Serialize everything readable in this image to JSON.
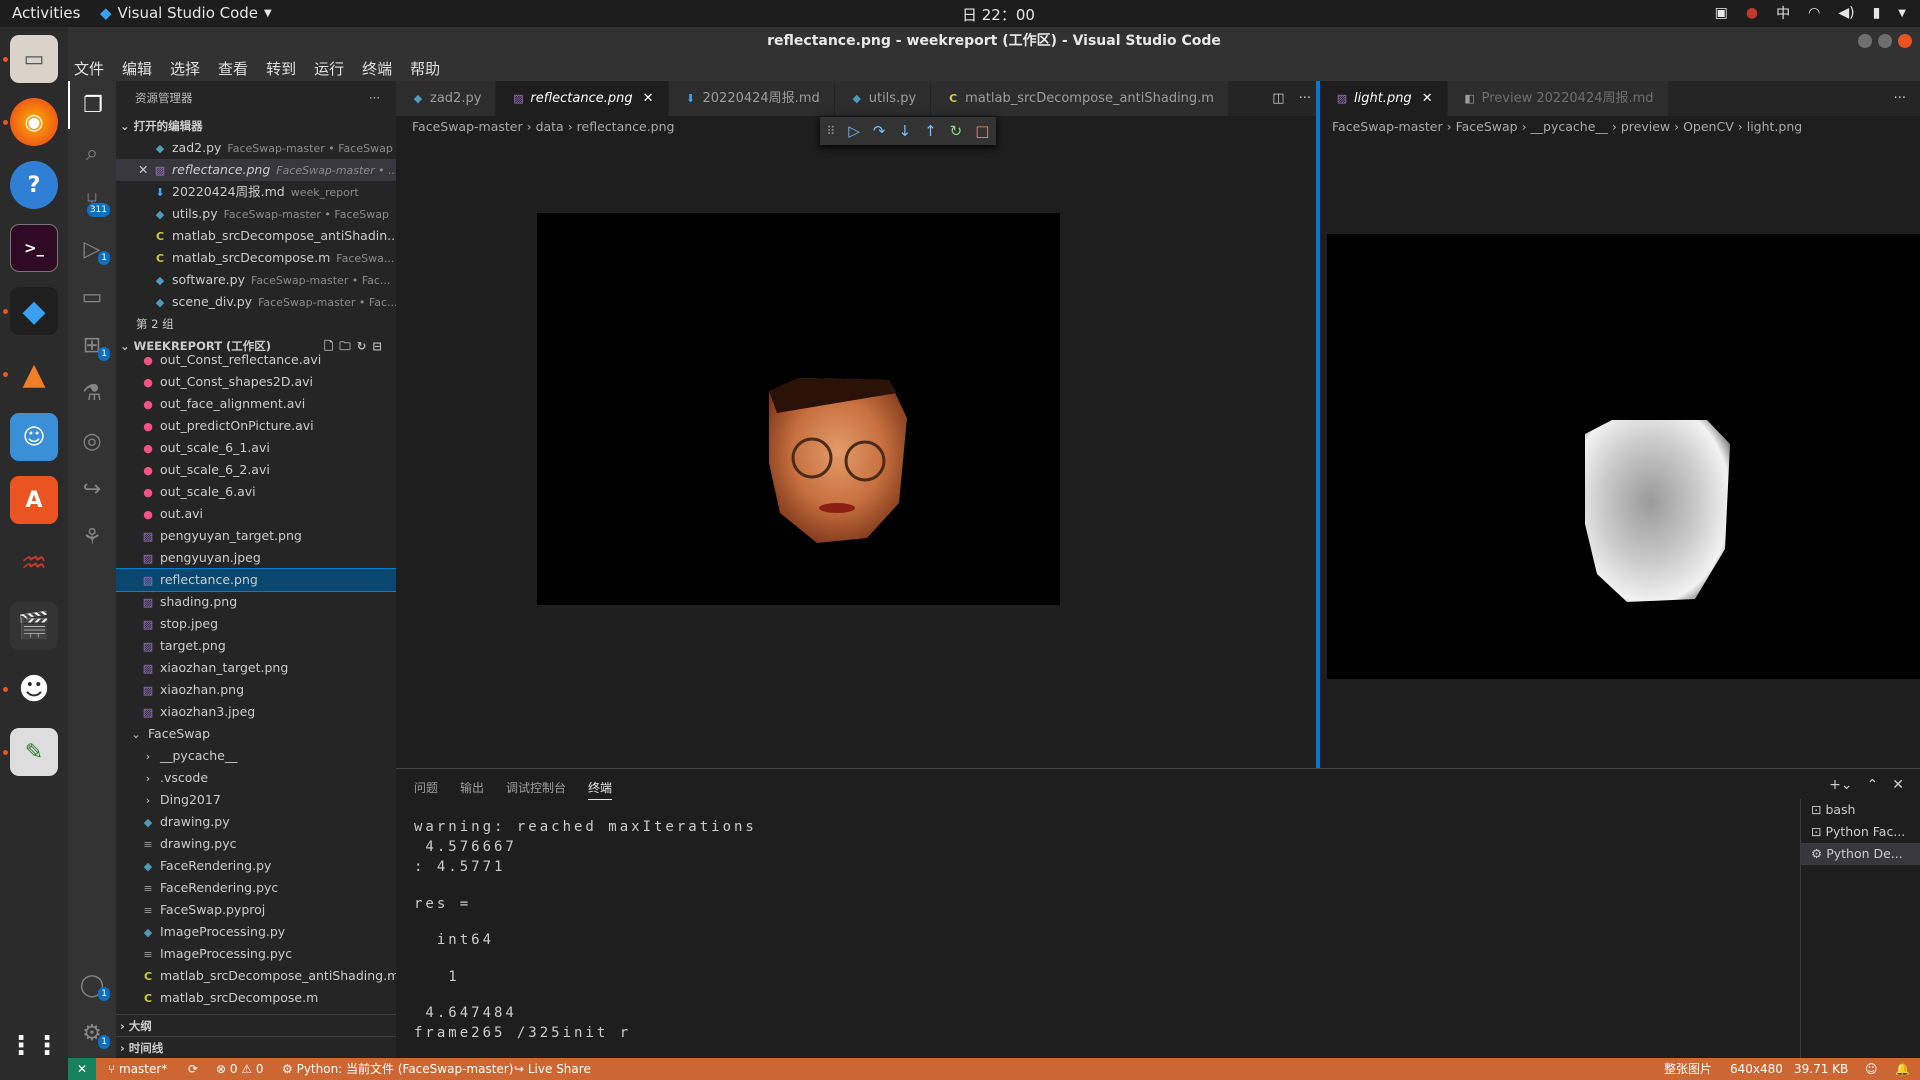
{
  "topbar": {
    "activities": "Activities",
    "app": "Visual Studio Code",
    "clock": "日 22：00",
    "ime": "中"
  },
  "window": {
    "title": "reflectance.png - weekreport (工作区) - Visual Studio Code"
  },
  "menu": [
    "文件",
    "编辑",
    "选择",
    "查看",
    "转到",
    "运行",
    "终端",
    "帮助"
  ],
  "activity": {
    "scm_badge": "311",
    "debug_badge": "1",
    "ext_badge": "1",
    "account_badge": "1",
    "settings_badge": "1"
  },
  "sidebar": {
    "title": "资源管理器",
    "open_editors_title": "打开的编辑器",
    "open_editors": [
      {
        "name": "zad2.py",
        "desc": "FaceSwap-master • FaceSwap",
        "type": "py"
      },
      {
        "name": "reflectance.png",
        "desc": "FaceSwap-master • ...",
        "type": "png"
      },
      {
        "name": "20220424周报.md",
        "desc": "week_report",
        "type": "md"
      },
      {
        "name": "utils.py",
        "desc": "FaceSwap-master • FaceSwap",
        "type": "py"
      },
      {
        "name": "matlab_srcDecompose_antiShadin...",
        "desc": "",
        "type": "cm"
      },
      {
        "name": "matlab_srcDecompose.m",
        "desc": "FaceSwa...",
        "type": "cm"
      },
      {
        "name": "software.py",
        "desc": "FaceSwap-master • Fac...",
        "type": "py"
      },
      {
        "name": "scene_div.py",
        "desc": "FaceSwap-master • Fac...",
        "type": "py"
      }
    ],
    "group2": "第 2 组",
    "workspace_title": "WEEKREPORT (工作区)",
    "files": [
      {
        "name": "out_Const_reflectance.avi",
        "type": "avi",
        "indent": 1
      },
      {
        "name": "out_Const_shapes2D.avi",
        "type": "avi",
        "indent": 1
      },
      {
        "name": "out_face_alignment.avi",
        "type": "avi",
        "indent": 1
      },
      {
        "name": "out_predictOnPicture.avi",
        "type": "avi",
        "indent": 1
      },
      {
        "name": "out_scale_6_1.avi",
        "type": "avi",
        "indent": 1
      },
      {
        "name": "out_scale_6_2.avi",
        "type": "avi",
        "indent": 1
      },
      {
        "name": "out_scale_6.avi",
        "type": "avi",
        "indent": 1
      },
      {
        "name": "out.avi",
        "type": "avi",
        "indent": 1
      },
      {
        "name": "pengyuyan_target.png",
        "type": "png",
        "indent": 1
      },
      {
        "name": "pengyuyan.jpeg",
        "type": "png",
        "indent": 1
      },
      {
        "name": "reflectance.png",
        "type": "png",
        "indent": 1,
        "selected": true
      },
      {
        "name": "shading.png",
        "type": "png",
        "indent": 1
      },
      {
        "name": "stop.jpeg",
        "type": "png",
        "indent": 1
      },
      {
        "name": "target.png",
        "type": "png",
        "indent": 1
      },
      {
        "name": "xiaozhan_target.png",
        "type": "png",
        "indent": 1
      },
      {
        "name": "xiaozhan.png",
        "type": "png",
        "indent": 1
      },
      {
        "name": "xiaozhan3.jpeg",
        "type": "png",
        "indent": 1
      },
      {
        "name": "FaceSwap",
        "type": "folder-open",
        "indent": 0
      },
      {
        "name": "__pycache__",
        "type": "folder",
        "indent": 1
      },
      {
        "name": ".vscode",
        "type": "folder",
        "indent": 1
      },
      {
        "name": "Ding2017",
        "type": "folder",
        "indent": 1
      },
      {
        "name": "drawing.py",
        "type": "py",
        "indent": 1
      },
      {
        "name": "drawing.pyc",
        "type": "txt",
        "indent": 1
      },
      {
        "name": "FaceRendering.py",
        "type": "py",
        "indent": 1
      },
      {
        "name": "FaceRendering.pyc",
        "type": "txt",
        "indent": 1
      },
      {
        "name": "FaceSwap.pyproj",
        "type": "txt",
        "indent": 1
      },
      {
        "name": "ImageProcessing.py",
        "type": "py",
        "indent": 1
      },
      {
        "name": "ImageProcessing.pyc",
        "type": "txt",
        "indent": 1
      },
      {
        "name": "matlab_srcDecompose_antiShading.m",
        "type": "cm",
        "indent": 1
      },
      {
        "name": "matlab_srcDecompose.m",
        "type": "cm",
        "indent": 1
      }
    ],
    "outline": "大纲",
    "timeline": "时间线"
  },
  "editor1": {
    "tabs": [
      {
        "label": "zad2.py",
        "type": "py"
      },
      {
        "label": "reflectance.png",
        "type": "png",
        "active": true
      },
      {
        "label": "20220424周报.md",
        "type": "md"
      },
      {
        "label": "utils.py",
        "type": "py"
      },
      {
        "label": "matlab_srcDecompose_antiShading.m",
        "type": "cm"
      }
    ],
    "breadcrumb": [
      "FaceSwap-master",
      "data",
      "reflectance.png"
    ]
  },
  "editor2": {
    "tabs": [
      {
        "label": "light.png",
        "type": "png",
        "active": true
      },
      {
        "label": "Preview 20220424周报.md",
        "type": "preview"
      }
    ],
    "breadcrumb": [
      "FaceSwap-master",
      "FaceSwap",
      "__pycache__",
      "preview",
      "OpenCV",
      "light.png"
    ]
  },
  "panel": {
    "tabs": [
      "问题",
      "输出",
      "调试控制台",
      "终端"
    ],
    "terminal_lines": [
      "warning: reached maxIterations",
      " 4.576667",
      ": 4.5771",
      "",
      "res =",
      "",
      "  int64",
      "",
      "   1",
      "",
      " 4.647484",
      "frame265 /325init r"
    ],
    "terminals": [
      "bash",
      "Python Fac...",
      "Python De..."
    ]
  },
  "status": {
    "branch": "master*",
    "errors": "0",
    "warnings": "0",
    "python": "Python: 当前文件 (FaceSwap-master)",
    "liveshare": "Live Share",
    "right": [
      "整张图片",
      "640x480",
      "39.71 KB"
    ]
  },
  "colors": {
    "statusbar": "#cc6633",
    "accent": "#0078d4",
    "selection": "#094771"
  }
}
